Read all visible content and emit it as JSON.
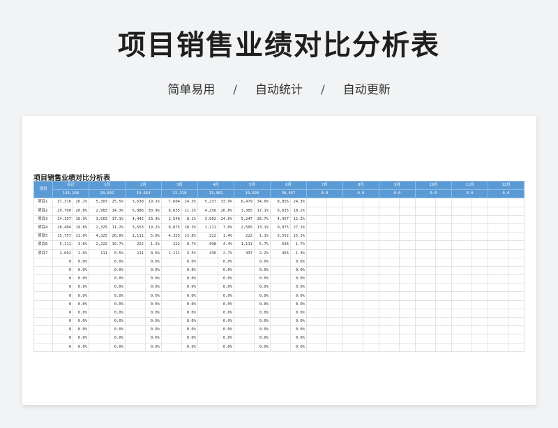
{
  "banner": {
    "title": "项目销售业绩对比分析表",
    "subtitle_items": [
      "简单易用",
      "自动统计",
      "自动更新"
    ],
    "separator": "/"
  },
  "sheet": {
    "title": "项目销售业绩对比分析表",
    "row_header": "项目",
    "columns": [
      "合计",
      "1月",
      "2月",
      "3月",
      "4月",
      "5月",
      "6月",
      "7月",
      "8月",
      "9月",
      "10月",
      "11月",
      "12月"
    ],
    "column_totals": [
      "143,168",
      "20,832",
      "19,664",
      "21,318",
      "13,962",
      "19,026",
      "30,467",
      "0.0",
      "0.0",
      "0.0",
      "0.0",
      "0.0",
      "0.0"
    ],
    "rows": [
      {
        "label": "项目1",
        "cells": [
          [
            "37,316",
            "26.1%"
          ],
          [
            "5,303",
            "25.5%"
          ],
          [
            "3,638",
            "19.1%"
          ],
          [
            "7,604",
            "24.3%"
          ],
          [
            "5,237",
            "33.9%"
          ],
          [
            "6,479",
            "34.0%"
          ],
          [
            "8,856",
            "24.3%"
          ]
        ]
      },
      {
        "label": "项目2",
        "cells": [
          [
            "29,760",
            "20.8%"
          ],
          [
            "2,983",
            "14.3%"
          ],
          [
            "5,886",
            "30.9%"
          ],
          [
            "6,635",
            "21.2%"
          ],
          [
            "4,256",
            "26.8%"
          ],
          [
            "3,365",
            "17.1%"
          ],
          [
            "6,635",
            "18.2%"
          ]
        ]
      },
      {
        "label": "项目3",
        "cells": [
          [
            "24,157",
            "16.9%"
          ],
          [
            "3,563",
            "17.1%"
          ],
          [
            "4,442",
            "23.3%"
          ],
          [
            "2,546",
            "8.1%"
          ],
          [
            "3,902",
            "24.6%"
          ],
          [
            "5,247",
            "26.7%"
          ],
          [
            "4,457",
            "12.2%"
          ]
        ]
      },
      {
        "label": "项目4",
        "cells": [
          [
            "28,404",
            "19.8%"
          ],
          [
            "2,325",
            "11.2%"
          ],
          [
            "3,653",
            "19.2%"
          ],
          [
            "8,875",
            "28.3%"
          ],
          [
            "1,111",
            "7.0%"
          ],
          [
            "2,565",
            "13.1%"
          ],
          [
            "9,875",
            "27.1%"
          ]
        ]
      },
      {
        "label": "项目5",
        "cells": [
          [
            "15,757",
            "11.0%"
          ],
          [
            "4,325",
            "20.8%"
          ],
          [
            "1,111",
            "5.8%"
          ],
          [
            "4,325",
            "13.8%"
          ],
          [
            "222",
            "1.4%"
          ],
          [
            "222",
            "1.1%"
          ],
          [
            "5,552",
            "15.2%"
          ]
        ]
      },
      {
        "label": "项目6",
        "cells": [
          [
            "5,111",
            "3.6%"
          ],
          [
            "2,222",
            "10.7%"
          ],
          [
            "222",
            "1.2%"
          ],
          [
            "222",
            "0.7%"
          ],
          [
            "698",
            "4.4%"
          ],
          [
            "1,111",
            "5.7%"
          ],
          [
            "636",
            "1.7%"
          ]
        ]
      },
      {
        "label": "项目7",
        "cells": [
          [
            "2,662",
            "1.9%"
          ],
          [
            "111",
            "0.5%"
          ],
          [
            "111",
            "0.6%"
          ],
          [
            "1,111",
            "3.5%"
          ],
          [
            "436",
            "2.7%"
          ],
          [
            "437",
            "2.2%"
          ],
          [
            "456",
            "1.3%"
          ]
        ]
      }
    ],
    "empty_row": {
      "total": [
        "0",
        "0.0%"
      ],
      "month_pct": "0.0%"
    },
    "empty_row_count": 11
  }
}
